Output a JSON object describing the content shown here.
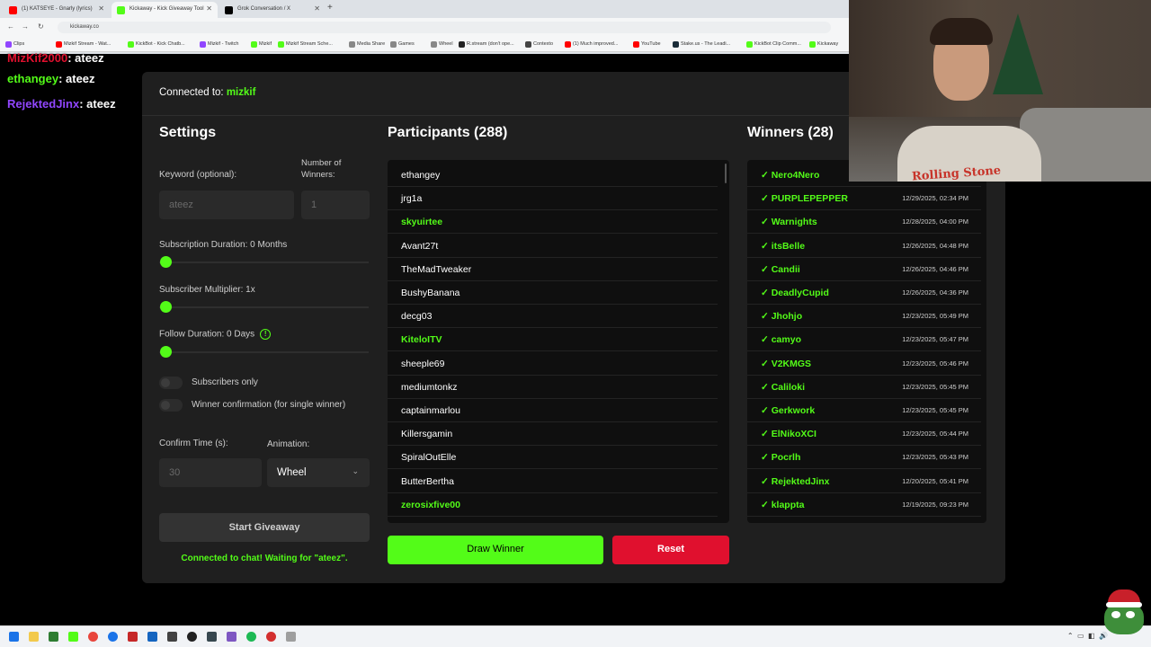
{
  "browser": {
    "tabs": [
      {
        "label": "(1) KATSEYE - Gnarly (lyrics)",
        "color": "#ff0000"
      },
      {
        "label": "Kickaway - Kick Giveaway Tool",
        "color": "#53fc18"
      },
      {
        "label": "Grok Conversation / X",
        "color": "#000000"
      }
    ],
    "url": "kickaway.co",
    "bookmarks": [
      {
        "label": "Clips",
        "color": "#9146ff"
      },
      {
        "label": "Mizkif Stream - Wat...",
        "color": "#ff0000"
      },
      {
        "label": "KickBot - Kick Chatb...",
        "color": "#53fc18"
      },
      {
        "label": "Mizkif - Twitch",
        "color": "#9146ff"
      },
      {
        "label": "Mizkif",
        "color": "#53fc18"
      },
      {
        "label": "Mizkif Stream Sche...",
        "color": "#53fc18"
      },
      {
        "label": "Media Share",
        "color": "#888888"
      },
      {
        "label": "Games",
        "color": "#888888"
      },
      {
        "label": "Wheel",
        "color": "#888888"
      },
      {
        "label": "R.stream (don't ope...",
        "color": "#222222"
      },
      {
        "label": "Contexto",
        "color": "#444444"
      },
      {
        "label": "(1) Much improved...",
        "color": "#ff0000"
      },
      {
        "label": "YouTube",
        "color": "#ff0000"
      },
      {
        "label": "Stake.us - The Leadi...",
        "color": "#1a2c38"
      },
      {
        "label": "KickBot Clip Comm...",
        "color": "#53fc18"
      },
      {
        "label": "Kickaway",
        "color": "#53fc18"
      }
    ]
  },
  "chat": [
    {
      "user": "MizKif2000",
      "msg": ": ateez",
      "color": "#e0102e"
    },
    {
      "user": "ethangey",
      "msg": ": ateez",
      "color": "#53fc18"
    },
    {
      "user": "RejektedJinx",
      "msg": ": ateez",
      "color": "#9146ff"
    }
  ],
  "app": {
    "connected_label": "Connected to:",
    "channel": "mizkif",
    "settings": {
      "title": "Settings",
      "keyword_label": "Keyword (optional):",
      "keyword_value": "ateez",
      "num_winners_label_1": "Number of",
      "num_winners_label_2": "Winners:",
      "num_winners_value": "1",
      "sub_duration_label": "Subscription Duration: 0 Months",
      "sub_multiplier_label": "Subscriber Multiplier: 1x",
      "follow_duration_label": "Follow Duration: 0 Days",
      "subs_only_label": "Subscribers only",
      "winner_confirm_label": "Winner confirmation (for single winner)",
      "confirm_time_label": "Confirm Time (s):",
      "confirm_time_value": "30",
      "animation_label": "Animation:",
      "animation_value": "Wheel",
      "start_button": "Start Giveaway",
      "status": "Connected to chat! Waiting for \"ateez\"."
    },
    "participants": {
      "title": "Participants (288)",
      "rows": [
        {
          "name": "ethangey",
          "sub": false
        },
        {
          "name": "jrg1a",
          "sub": false
        },
        {
          "name": "skyuirtee",
          "sub": true
        },
        {
          "name": "Avant27t",
          "sub": false
        },
        {
          "name": "TheMadTweaker",
          "sub": false
        },
        {
          "name": "BushyBanana",
          "sub": false
        },
        {
          "name": "decg03",
          "sub": false
        },
        {
          "name": "KiteloITV",
          "sub": true
        },
        {
          "name": "sheeple69",
          "sub": false
        },
        {
          "name": "mediumtonkz",
          "sub": false
        },
        {
          "name": "captainmarlou",
          "sub": false
        },
        {
          "name": "Killersgamin",
          "sub": false
        },
        {
          "name": "SpiralOutElle",
          "sub": false
        },
        {
          "name": "ButterBertha",
          "sub": false
        },
        {
          "name": "zerosixfive00",
          "sub": true
        }
      ]
    },
    "winners": {
      "title": "Winners (28)",
      "rows": [
        {
          "name": "✓ Nero4Nero",
          "date": ""
        },
        {
          "name": "✓ PURPLEPEPPER",
          "date": "12/29/2025, 02:34 PM"
        },
        {
          "name": "✓ Warnights",
          "date": "12/28/2025, 04:00 PM"
        },
        {
          "name": "✓ itsBelle",
          "date": "12/26/2025, 04:48 PM"
        },
        {
          "name": "✓ Candii",
          "date": "12/26/2025, 04:46 PM"
        },
        {
          "name": "✓ DeadlyCupid",
          "date": "12/26/2025, 04:36 PM"
        },
        {
          "name": "✓ Jhohjo",
          "date": "12/23/2025, 05:49 PM"
        },
        {
          "name": "✓ camyo",
          "date": "12/23/2025, 05:47 PM"
        },
        {
          "name": "✓ V2KMGS",
          "date": "12/23/2025, 05:46 PM"
        },
        {
          "name": "✓ Caliloki",
          "date": "12/23/2025, 05:45 PM"
        },
        {
          "name": "✓ Gerkwork",
          "date": "12/23/2025, 05:45 PM"
        },
        {
          "name": "✓ ElNikoXCI",
          "date": "12/23/2025, 05:44 PM"
        },
        {
          "name": "✓ Pocrlh",
          "date": "12/23/2025, 05:43 PM"
        },
        {
          "name": "✓ RejektedJinx",
          "date": "12/20/2025, 05:41 PM"
        },
        {
          "name": "✓ klappta",
          "date": "12/19/2025, 09:23 PM"
        }
      ]
    },
    "draw_button": "Draw Winner",
    "reset_button": "Reset"
  },
  "webcam": {
    "shirt_text": "Rolling Stone"
  },
  "colors": {
    "accent": "#53fc18",
    "danger": "#e0102e",
    "card": "#1f1f1f"
  }
}
